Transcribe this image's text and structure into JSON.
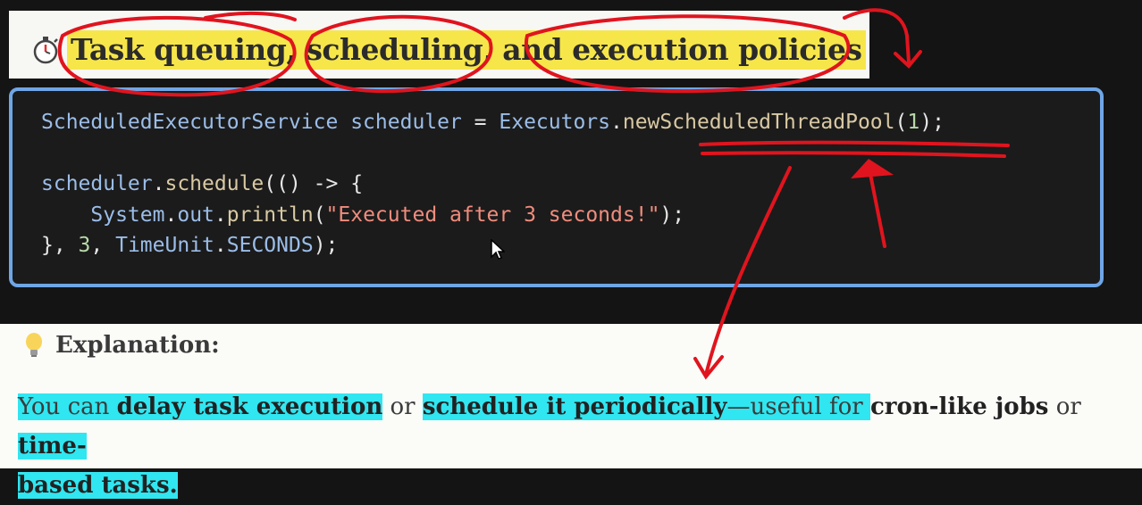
{
  "heading": {
    "icon": "stopwatch-icon",
    "title": "Task queuing, scheduling, and execution policies",
    "highlight_color": "#f6e64a"
  },
  "code": {
    "line1": {
      "type": "ScheduledExecutorService",
      "var": "scheduler",
      "eq": " = ",
      "cls": "Executors",
      "dot": ".",
      "method": "newScheduledThreadPool",
      "open": "(",
      "arg": "1",
      "close": ");"
    },
    "line3": {
      "var": "scheduler",
      "dot": ".",
      "method": "schedule",
      "rest": "(() -> {"
    },
    "line4": {
      "cls": "System",
      "dot1": ".",
      "field": "out",
      "dot2": ".",
      "method": "println",
      "open": "(",
      "str": "\"Executed after 3 seconds!\"",
      "close": ");"
    },
    "line5": {
      "start": "}, ",
      "num": "3",
      "sep": ", ",
      "cls": "TimeUnit",
      "dot": ".",
      "const": "SECONDS",
      "end": ");"
    }
  },
  "explanation": {
    "icon": "lightbulb-icon",
    "title": "Explanation:",
    "p1": "You can ",
    "b1": "delay task execution",
    "p2": " or ",
    "b2": "schedule it periodically",
    "p3": "—useful for ",
    "b3": "cron-like jobs",
    "p4": " or ",
    "b4": "time-",
    "b5": "based tasks."
  },
  "colors": {
    "annotation_red": "#e0141e",
    "code_border_blue": "#6fa6e6",
    "text_highlight_cyan": "#30e6f0"
  }
}
